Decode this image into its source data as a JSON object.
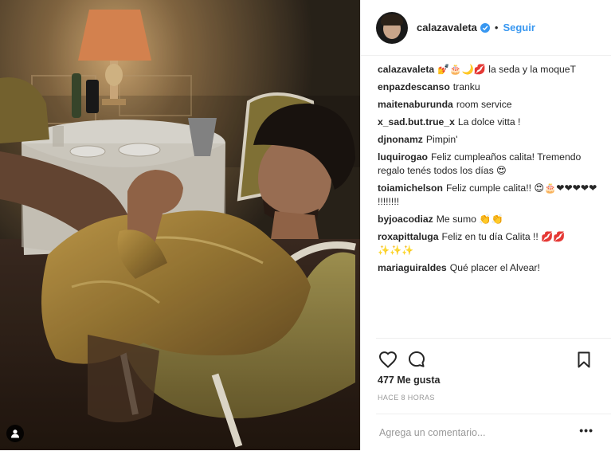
{
  "post": {
    "username": "calazavaleta",
    "follow_label": "Seguir",
    "separator": "•",
    "likes": "477 Me gusta",
    "time": "HACE 8 HORAS",
    "comment_placeholder": "Agrega un comentario...",
    "more_label": "•••"
  },
  "comments": [
    {
      "user": "calazavaleta",
      "text": "💅🎂🌙💋 la seda y la moqueT"
    },
    {
      "user": "enpazdescanso",
      "text": "tranku"
    },
    {
      "user": "maitenaburunda",
      "text": "room service"
    },
    {
      "user": "x_sad.but.true_x",
      "text": "La dolce vitta !"
    },
    {
      "user": "djnonamz",
      "text": "Pimpin'"
    },
    {
      "user": "luquirogao",
      "text": "Feliz cumpleaños calita! Tremendo regalo tenés todos los días 😍"
    },
    {
      "user": "toiamichelson",
      "text": "Feliz cumple calita!! 😍🎂❤❤❤❤❤ !!!!!!!!"
    },
    {
      "user": "byjoacodiaz",
      "text": "Me sumo 👏👏"
    },
    {
      "user": "roxapittaluga",
      "text": "Feliz en tu día Calita !! 💋💋 ✨✨✨"
    },
    {
      "user": "mariaguiraldes",
      "text": "Qué placer el Alvear!"
    }
  ],
  "colors": {
    "accent": "#3897f0",
    "text": "#262626",
    "muted": "#999999",
    "border": "#efefef"
  },
  "icons": {
    "like": "heart-icon",
    "comment": "comment-bubble-icon",
    "save": "bookmark-icon",
    "verified": "verified-badge-icon",
    "user_tag": "person-tag-icon"
  }
}
